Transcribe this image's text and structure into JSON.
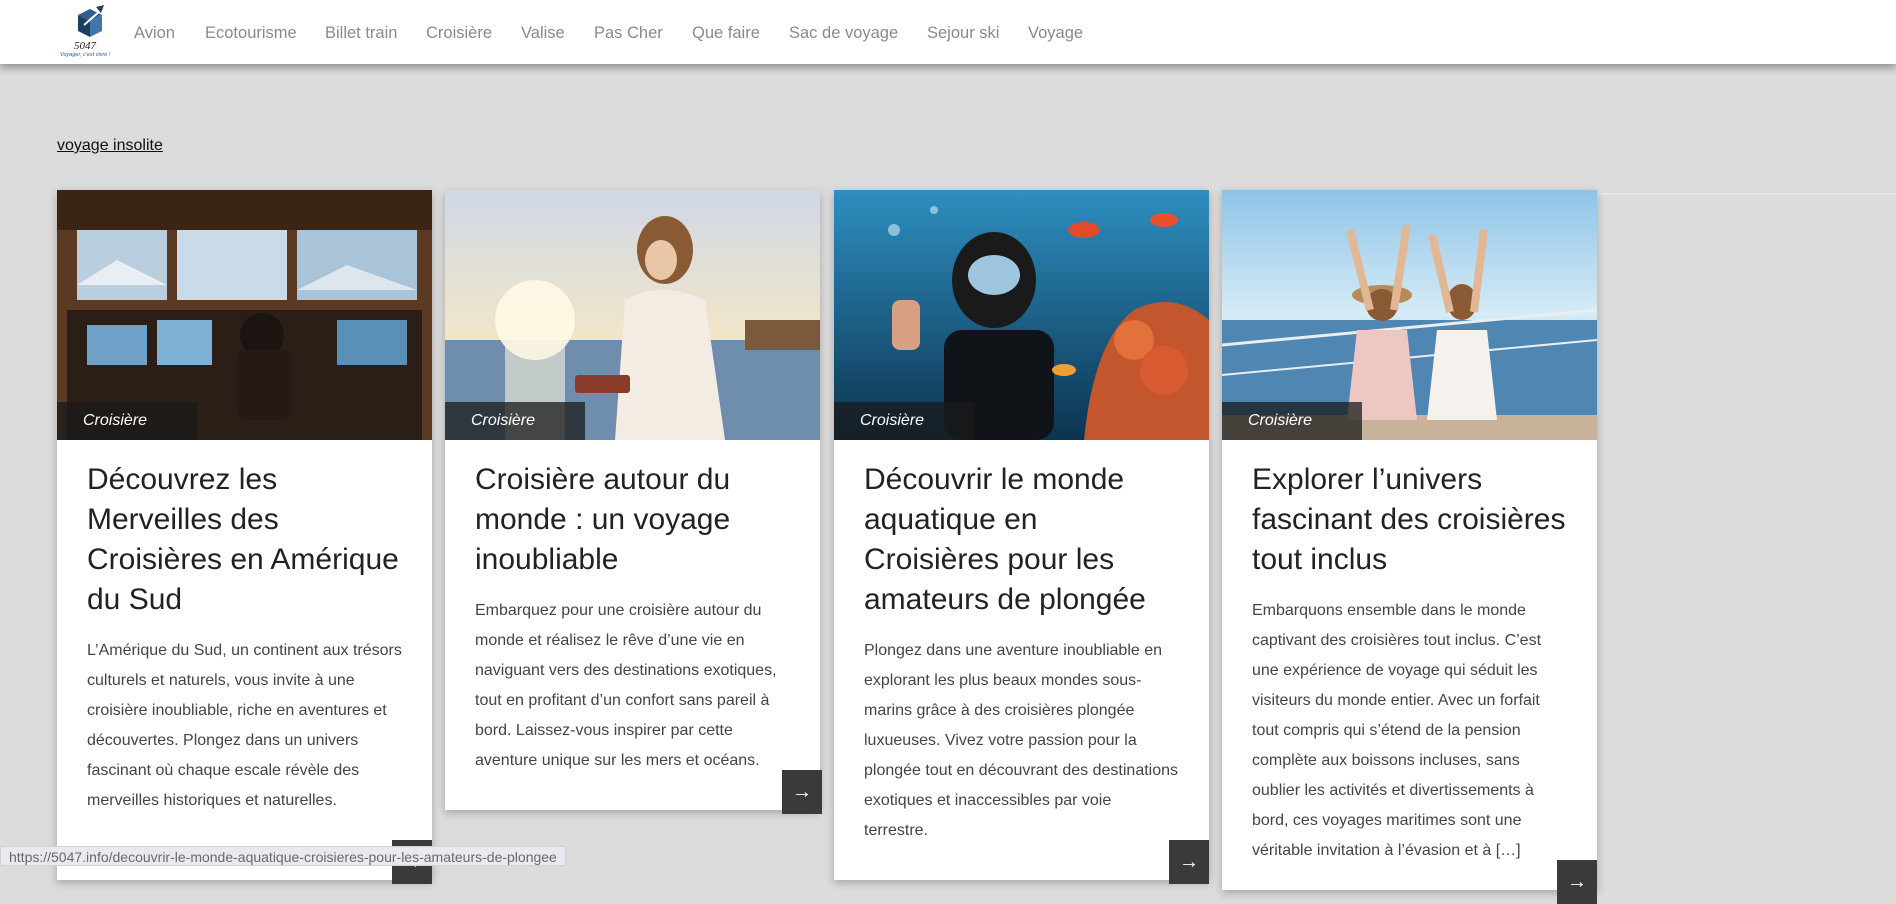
{
  "logo": {
    "number": "5047",
    "tagline": "Voyager, c'est vivre !"
  },
  "nav": {
    "items": [
      "Avion",
      "Ecotourisme",
      "Billet train",
      "Croisière",
      "Valise",
      "Pas Cher",
      "Que faire",
      "Sac de voyage",
      "Sejour ski",
      "Voyage"
    ]
  },
  "category_link": "voyage insolite",
  "cards": [
    {
      "category": "Croisière",
      "title": "Découvrez les Merveilles des Croisières en Amérique du Sud",
      "excerpt": "L’Amérique du Sud, un continent aux trésors culturels et naturels, vous invite à une croisière inoubliable, riche en aventures et découvertes. Plongez dans un univers fascinant où chaque escale révèle des merveilles historiques et naturelles.",
      "more": "→"
    },
    {
      "category": "Croisière",
      "title": "Croisière autour du monde : un voyage inoubliable",
      "excerpt": "Embarquez pour une croisière autour du monde et réalisez le rêve d’une vie en naviguant vers des destinations exotiques, tout en profitant d’un confort sans pareil à bord. Laissez-vous inspirer par cette aventure unique sur les mers et océans.",
      "more": "→"
    },
    {
      "category": "Croisière",
      "title": "Découvrir le monde aquatique en Croisières pour les amateurs de plongée",
      "excerpt": "Plongez dans une aventure inoubliable en explorant les plus beaux mondes sous-marins grâce à des croisières plongée luxueuses. Vivez votre passion pour la plongée tout en découvrant des destinations exotiques et inaccessibles par voie terrestre.",
      "more": "→"
    },
    {
      "category": "Croisière",
      "title": "Explorer l’univers fascinant des croisières tout inclus",
      "excerpt": "Embarquons ensemble dans le monde captivant des croisières tout inclus. C’est une expérience de voyage qui séduit les visiteurs du monde entier. Avec un forfait tout compris qui s’étend de la pension complète aux boissons incluses, sans oublier les activités et divertissements à bord, ces voyages maritimes sont une véritable invitation à l’évasion et à […]",
      "more": "→"
    }
  ],
  "status_url": "https://5047.info/decouvrir-le-monde-aquatique-croisieres-pour-les-amateurs-de-plongee"
}
